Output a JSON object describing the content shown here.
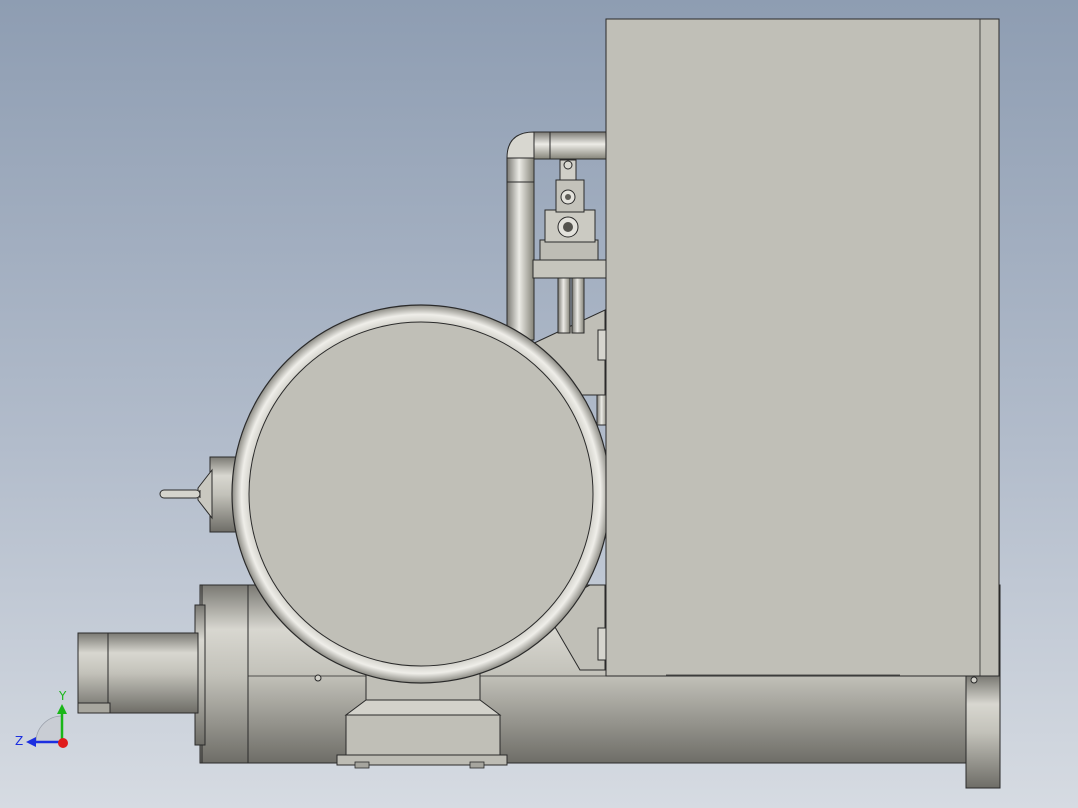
{
  "viewport": {
    "background_top": "#8e9db2",
    "background_bottom": "#d6dbe2"
  },
  "model": {
    "body_color": "#c0bfb7",
    "edge_color": "#2a2a2a",
    "shadow_color": "#8c8b84",
    "highlight_color": "#e6e5df"
  },
  "triad": {
    "y_label": "Y",
    "z_label": "Z",
    "y_color": "#19b619",
    "z_color": "#1c2fe0",
    "origin_color": "#e01b1b"
  }
}
